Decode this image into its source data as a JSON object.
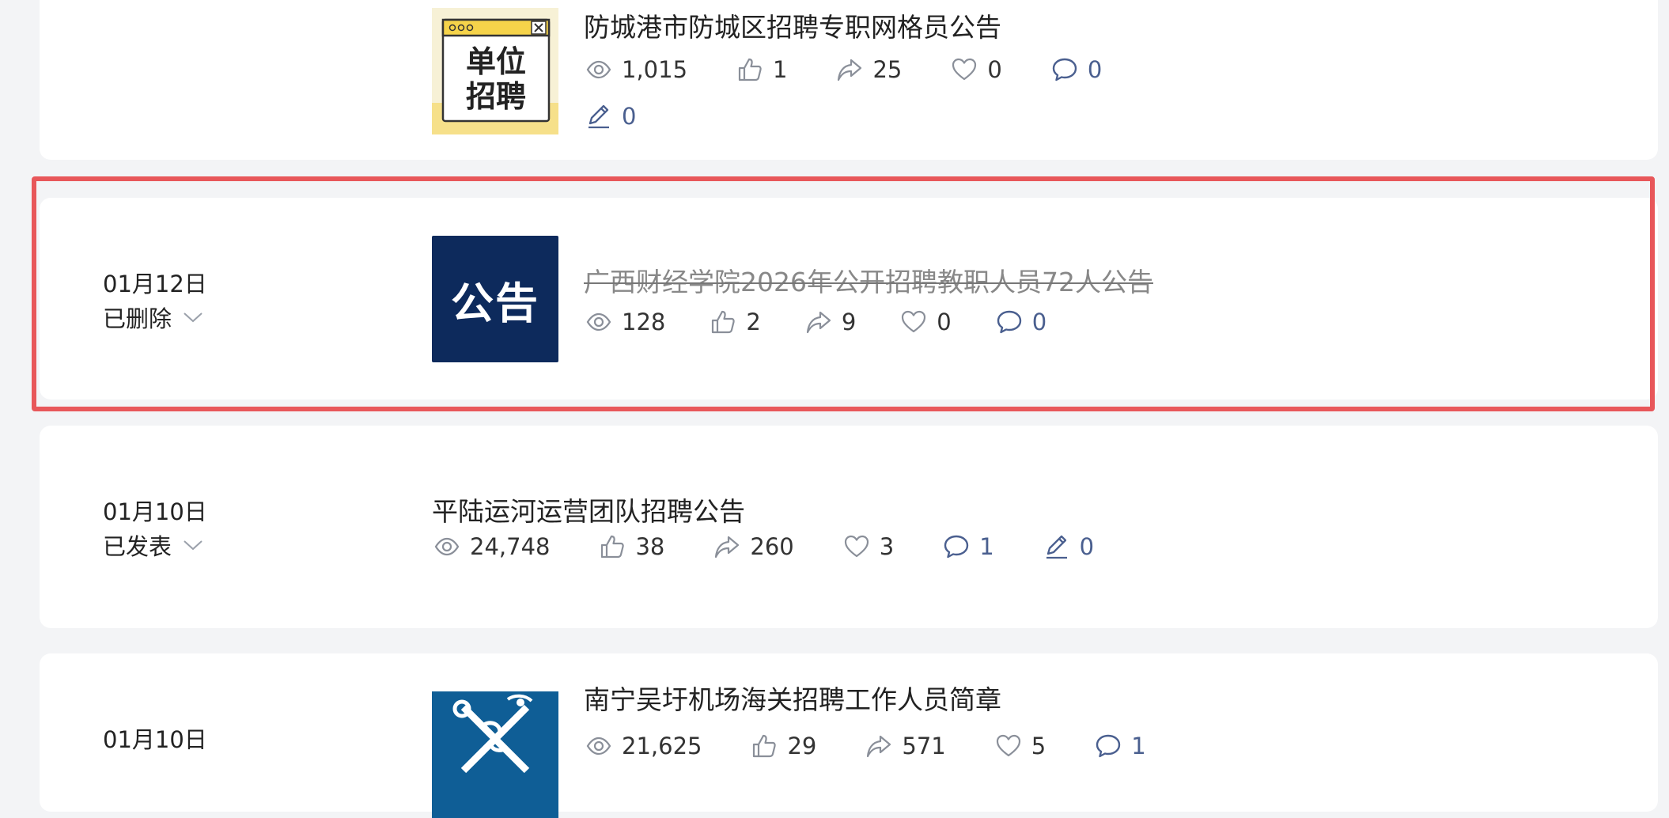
{
  "articles": [
    {
      "title": "防城港市防城区招聘专职网格员公告",
      "thumb_text": [
        "单位",
        "招聘"
      ],
      "stats": {
        "views": "1,015",
        "likes": "1",
        "shares": "25",
        "favorites": "0",
        "comments": "0",
        "notes": "0"
      }
    },
    {
      "date": "01月12日",
      "status": "已删除",
      "title": "广西财经学院2026年公开招聘教职人员72人公告",
      "thumb_text": "公告",
      "stats": {
        "views": "128",
        "likes": "2",
        "shares": "9",
        "favorites": "0",
        "comments": "0"
      }
    },
    {
      "date": "01月10日",
      "status": "已发表",
      "title": "平陆运河运营团队招聘公告",
      "stats": {
        "views": "24,748",
        "likes": "38",
        "shares": "260",
        "favorites": "3",
        "comments": "1",
        "notes": "0"
      }
    },
    {
      "date": "01月10日",
      "title": "南宁吴圩机场海关招聘工作人员简章",
      "stats": {
        "views": "21,625",
        "likes": "29",
        "shares": "571",
        "favorites": "5",
        "comments": "1"
      }
    }
  ],
  "colors": {
    "highlight": "#e8575a",
    "notice_thumb_bg": "#0d2a5c",
    "stat_blue": "#4a5f8f"
  },
  "icons": [
    "eye-icon",
    "thumbs-up-icon",
    "share-icon",
    "heart-icon",
    "comment-icon",
    "pen-icon",
    "chevron-down-icon"
  ]
}
